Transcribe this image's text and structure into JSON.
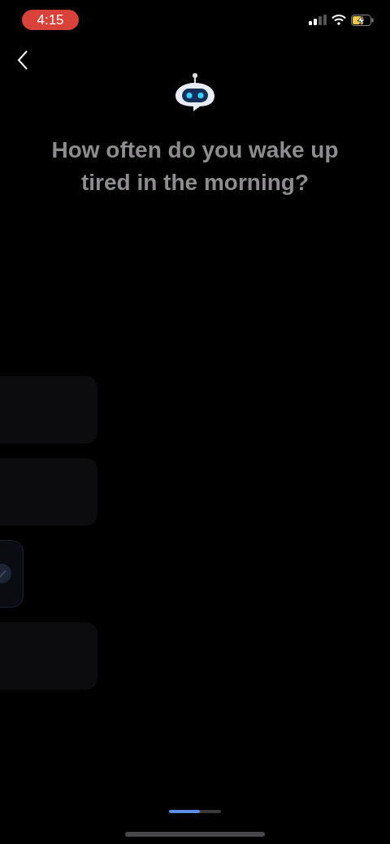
{
  "status_bar": {
    "time": "4:15"
  },
  "question": "How often do you wake up tired in the morning?",
  "options": [
    {
      "selected": false
    },
    {
      "selected": false
    },
    {
      "selected": true
    },
    {
      "selected": false
    }
  ],
  "progress": {
    "level": 0.6
  }
}
